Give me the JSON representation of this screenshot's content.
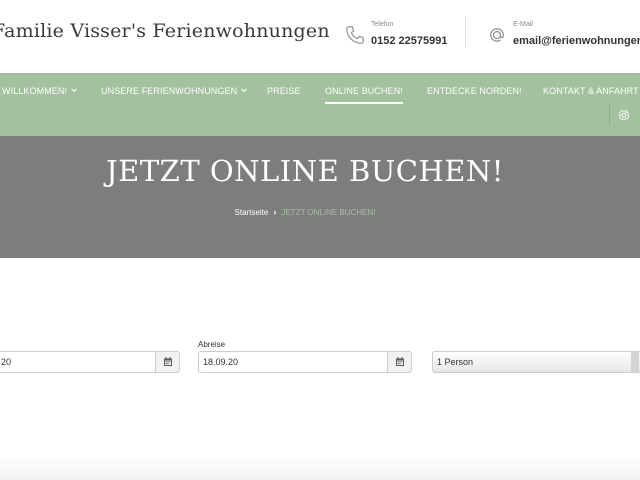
{
  "header": {
    "site_title": "Familie Visser's Ferienwohnungen",
    "phone": {
      "label": "Telefon",
      "value": "0152 22575991",
      "icon": "phone-icon"
    },
    "email": {
      "label": "E-Mail",
      "value": "email@ferienwohnungen-visser.de",
      "icon": "at-icon"
    }
  },
  "nav": {
    "items": [
      {
        "label": "WILLKOMMEN!",
        "dropdown": true
      },
      {
        "label": "UNSERE FERIENWOHNUNGEN",
        "dropdown": true
      },
      {
        "label": "PREISE",
        "dropdown": false
      },
      {
        "label": "ONLINE BUCHEN!",
        "dropdown": false,
        "active": true
      },
      {
        "label": "ENTDECKE NORDEN!",
        "dropdown": false
      },
      {
        "label": "KONTAKT & ANFAHRT",
        "dropdown": false
      }
    ],
    "social_icon": "instagram-icon"
  },
  "hero": {
    "title": "JETZT ONLINE BUCHEN!",
    "breadcrumb": {
      "home": "Startseite",
      "separator": "›",
      "current": "JETZT ONLINE BUCHEN!"
    }
  },
  "form": {
    "arrival": {
      "value": "20"
    },
    "departure": {
      "label": "Abreise",
      "value": "18.09.20"
    },
    "guests": {
      "value": "1 Person"
    },
    "calendar_icon": "calendar-icon"
  },
  "colors": {
    "nav_green": "#a3c19f",
    "hero_gray": "#7d7d7d",
    "breadcrumb_current": "#a3c19f"
  }
}
